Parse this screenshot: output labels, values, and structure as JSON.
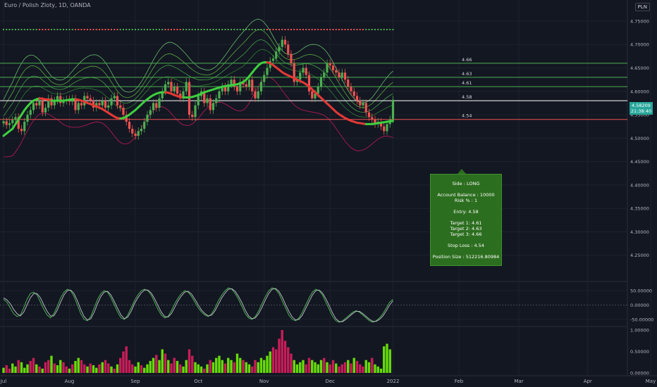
{
  "header": {
    "title": "Euro / Polish Zloty, 1D, OANDA",
    "currency": "PLN"
  },
  "chart_data": [
    {
      "type": "line",
      "title": "Euro / Polish Zloty, 1D, OANDA",
      "ylim": [
        4.2,
        4.78
      ],
      "y_ticks": [
        "4.75000",
        "4.70000",
        "4.65000",
        "4.60000",
        "4.55000",
        "4.50000",
        "4.45000",
        "4.40000",
        "4.35000",
        "4.30000",
        "4.25000"
      ],
      "y_tick_values": [
        4.75,
        4.7,
        4.65,
        4.6,
        4.55,
        4.5,
        4.45,
        4.4,
        4.35,
        4.3,
        4.25
      ],
      "x_ticks": [
        "Jul",
        "Aug",
        "Sep",
        "Oct",
        "Nov",
        "Dec",
        "2022",
        "Feb",
        "Mar",
        "Apr",
        "May",
        "Jun"
      ],
      "x_tick_index": [
        0,
        22,
        44,
        65,
        87,
        109,
        130,
        152,
        172,
        195,
        216,
        238
      ],
      "series": [
        {
          "values": [
            4.536,
            4.528,
            4.532,
            4.539,
            4.545,
            4.52,
            4.515,
            4.535,
            4.55,
            4.56,
            4.575,
            4.57,
            4.58,
            4.555,
            4.565,
            4.585,
            4.57,
            4.58,
            4.59,
            4.575,
            4.58,
            4.583,
            4.578,
            4.585,
            4.56,
            4.575,
            4.57,
            4.59,
            4.585,
            4.58,
            4.565,
            4.575,
            4.57,
            4.58,
            4.565,
            4.57,
            4.585,
            4.59,
            4.57,
            4.565,
            4.55,
            4.535,
            4.52,
            4.51,
            4.505,
            4.515,
            4.52,
            4.535,
            4.55,
            4.56,
            4.575,
            4.565,
            4.585,
            4.6,
            4.615,
            4.62,
            4.6,
            4.61,
            4.595,
            4.585,
            4.6,
            4.62,
            4.55,
            4.545,
            4.57,
            4.59,
            4.6,
            4.575,
            4.585,
            4.56,
            4.575,
            4.585,
            4.6,
            4.61,
            4.6,
            4.615,
            4.625,
            4.61,
            4.6,
            4.62,
            4.615,
            4.61,
            4.625,
            4.6,
            4.585,
            4.6,
            4.62,
            4.635,
            4.65,
            4.665,
            4.67,
            4.685,
            4.695,
            4.71,
            4.7,
            4.68,
            4.66,
            4.62,
            4.625,
            4.64,
            4.65,
            4.635,
            4.6,
            4.585,
            4.595,
            4.61,
            4.63,
            4.64,
            4.66,
            4.655,
            4.645,
            4.64,
            4.63,
            4.64,
            4.625,
            4.61,
            4.6,
            4.59,
            4.58,
            4.57,
            4.575,
            4.555,
            4.545,
            4.54,
            4.53,
            4.535,
            4.525,
            4.515,
            4.53,
            4.54,
            4.58209
          ],
          "mode": "candles"
        },
        {
          "name": "",
          "values": [
            4.505,
            4.51,
            4.515,
            4.52,
            4.53,
            4.54,
            4.55,
            4.56,
            4.568,
            4.575,
            4.58,
            4.583,
            4.585,
            4.584,
            4.583,
            4.582,
            4.58,
            4.58,
            4.58,
            4.58,
            4.58,
            4.581,
            4.582,
            4.583,
            4.583,
            4.582,
            4.58,
            4.578,
            4.575,
            4.573,
            4.57,
            4.568,
            4.565,
            4.562,
            4.558,
            4.554,
            4.55,
            4.546,
            4.543,
            4.542,
            4.543,
            4.546,
            4.55,
            4.555,
            4.56,
            4.566,
            4.572,
            4.578,
            4.583,
            4.588,
            4.592,
            4.595,
            4.597,
            4.598,
            4.598,
            4.597,
            4.595,
            4.592,
            4.59,
            4.588,
            4.587,
            4.587,
            4.587,
            4.588,
            4.59,
            4.592,
            4.595,
            4.598,
            4.6,
            4.602,
            4.604,
            4.606,
            4.608,
            4.61,
            4.611,
            4.612,
            4.613,
            4.614,
            4.615,
            4.617,
            4.62,
            4.625,
            4.632,
            4.64,
            4.648,
            4.655,
            4.66,
            4.662,
            4.662,
            4.66,
            4.656,
            4.651,
            4.646,
            4.641,
            4.637,
            4.634,
            4.631,
            4.628,
            4.625,
            4.622,
            4.619,
            4.615,
            4.61,
            4.604,
            4.598,
            4.592,
            4.586,
            4.58,
            4.574,
            4.568,
            4.562,
            4.556,
            4.551,
            4.547,
            4.543,
            4.54,
            4.537,
            4.535,
            4.533,
            4.532,
            4.531,
            4.53,
            4.53,
            4.53,
            4.531,
            4.532,
            4.533,
            4.534,
            4.535,
            4.536,
            4.537
          ],
          "mode": "trend"
        }
      ],
      "annotations": [
        "4.66",
        "4.63",
        "4.61",
        "4.58",
        "4.54"
      ],
      "annotation_values": [
        4.66,
        4.63,
        4.61,
        4.58,
        4.54
      ],
      "annotation_colors": [
        "#4caf50",
        "#4caf50",
        "#4caf50",
        "#ffffff",
        "#ef5350"
      ],
      "last_price": "4.58209",
      "countdown": "21:38:40"
    },
    {
      "type": "line",
      "ylim": [
        -70,
        70
      ],
      "y_ticks": [
        "50.00000",
        "0.00000",
        "-50.00000"
      ],
      "y_tick_values": [
        50,
        0,
        -50
      ],
      "series": [
        {
          "name": "",
          "values": [
            20,
            10,
            -10,
            -30,
            -40,
            -35,
            -10,
            20,
            40,
            45,
            35,
            10,
            -15,
            -35,
            -45,
            -30,
            -5,
            25,
            45,
            55,
            50,
            30,
            0,
            -30,
            -50,
            -55,
            -40,
            -10,
            20,
            40,
            50,
            45,
            25,
            0,
            -25,
            -45,
            -50,
            -35,
            -10,
            15,
            35,
            50,
            55,
            50,
            35,
            10,
            -15,
            -35,
            -45,
            -40,
            -20,
            5,
            25,
            40,
            50,
            45,
            30,
            10,
            -10,
            -25,
            -35,
            -40,
            -30,
            -10,
            15,
            35,
            50,
            60,
            55,
            40,
            20,
            -5,
            -30,
            -45,
            -50,
            -40,
            -20,
            5,
            30,
            50,
            60,
            55,
            40,
            15,
            -10,
            -35,
            -50,
            -55,
            -45,
            -25,
            0,
            25,
            45,
            55,
            50,
            35,
            10,
            -15,
            -40,
            -55,
            -60,
            -55,
            -45,
            -35,
            -25,
            -20,
            -25,
            -35,
            -45,
            -55,
            -60,
            -55,
            -45,
            -30,
            -10,
            10,
            20
          ],
          "mode": "osc",
          "color": "#4caf50"
        },
        {
          "name": "",
          "values": [
            25,
            18,
            5,
            -15,
            -30,
            -38,
            -25,
            0,
            25,
            40,
            40,
            25,
            0,
            -22,
            -38,
            -38,
            -18,
            10,
            35,
            50,
            52,
            40,
            15,
            -15,
            -40,
            -52,
            -48,
            -25,
            5,
            30,
            45,
            48,
            35,
            12,
            -12,
            -35,
            -48,
            -42,
            -22,
            5,
            25,
            42,
            52,
            52,
            42,
            22,
            -2,
            -25,
            -40,
            -42,
            -30,
            -8,
            15,
            32,
            45,
            48,
            38,
            20,
            0,
            -18,
            -30,
            -38,
            -35,
            -20,
            2,
            25,
            42,
            55,
            57,
            48,
            30,
            8,
            -18,
            -38,
            -48,
            -45,
            -30,
            -8,
            18,
            40,
            55,
            58,
            48,
            28,
            2,
            -22,
            -42,
            -52,
            -50,
            -35,
            -12,
            12,
            35,
            50,
            52,
            42,
            22,
            -2,
            -28,
            -48,
            -58,
            -58,
            -50,
            -40,
            -30,
            -22,
            -22,
            -30,
            -40,
            -50,
            -57,
            -57,
            -50,
            -38,
            -20,
            0,
            15
          ],
          "mode": "osc",
          "color": "#b2b5be"
        }
      ]
    },
    {
      "type": "bar",
      "ylim": [
        0,
        1.05
      ],
      "y_ticks": [
        "1.00000",
        "0.50000",
        "0.00000"
      ],
      "y_tick_values": [
        1.0,
        0.5,
        0.0
      ],
      "values": [
        0.12,
        0.18,
        0.1,
        0.22,
        0.15,
        0.3,
        0.25,
        0.12,
        0.2,
        0.28,
        0.35,
        0.2,
        0.15,
        0.1,
        0.25,
        0.3,
        0.4,
        0.22,
        0.18,
        0.3,
        0.25,
        0.15,
        0.1,
        0.2,
        0.28,
        0.35,
        0.3,
        0.2,
        0.15,
        0.22,
        0.18,
        0.12,
        0.2,
        0.25,
        0.3,
        0.22,
        0.15,
        0.1,
        0.2,
        0.35,
        0.5,
        0.62,
        0.3,
        0.2,
        0.15,
        0.25,
        0.18,
        0.12,
        0.2,
        0.28,
        0.35,
        0.42,
        0.3,
        0.55,
        0.45,
        0.3,
        0.22,
        0.35,
        0.28,
        0.2,
        0.15,
        0.3,
        0.55,
        0.4,
        0.25,
        0.2,
        0.15,
        0.1,
        0.2,
        0.3,
        0.25,
        0.35,
        0.4,
        0.3,
        0.22,
        0.35,
        0.3,
        0.25,
        0.45,
        0.35,
        0.3,
        0.25,
        0.2,
        0.15,
        0.3,
        0.25,
        0.35,
        0.3,
        0.4,
        0.5,
        0.6,
        0.55,
        0.8,
        1.0,
        0.75,
        0.6,
        0.45,
        0.3,
        0.2,
        0.25,
        0.3,
        0.2,
        0.35,
        0.3,
        0.25,
        0.2,
        0.3,
        0.35,
        0.25,
        0.2,
        0.3,
        0.22,
        0.15,
        0.2,
        0.25,
        0.3,
        0.22,
        0.35,
        0.28,
        0.2,
        0.15,
        0.3,
        0.25,
        0.35,
        0.2,
        0.15,
        0.1,
        0.62,
        0.68,
        0.55
      ],
      "bar_colors": [
        "g",
        "r",
        "r",
        "g",
        "g",
        "r",
        "g",
        "g",
        "g",
        "r",
        "r",
        "g",
        "r",
        "g",
        "r",
        "r",
        "g",
        "r",
        "g",
        "g",
        "r",
        "r",
        "g",
        "r",
        "g",
        "g",
        "r",
        "r",
        "g",
        "r",
        "g",
        "g",
        "r",
        "g",
        "r",
        "r",
        "g",
        "r",
        "g",
        "r",
        "r",
        "r",
        "r",
        "r",
        "g",
        "g",
        "r",
        "g",
        "g",
        "g",
        "g",
        "r",
        "g",
        "g",
        "r",
        "g",
        "r",
        "r",
        "g",
        "r",
        "g",
        "g",
        "r",
        "r",
        "g",
        "g",
        "g",
        "r",
        "g",
        "r",
        "g",
        "g",
        "g",
        "g",
        "r",
        "g",
        "g",
        "r",
        "g",
        "g",
        "r",
        "g",
        "g",
        "r",
        "r",
        "g",
        "g",
        "g",
        "g",
        "g",
        "r",
        "r",
        "r",
        "r",
        "r",
        "r",
        "r",
        "g",
        "g",
        "g",
        "g",
        "r",
        "r",
        "g",
        "g",
        "g",
        "g",
        "r",
        "g",
        "r",
        "r",
        "g",
        "r",
        "r",
        "r",
        "g",
        "r",
        "g",
        "r",
        "r",
        "r",
        "g",
        "g",
        "r",
        "g",
        "g",
        "g",
        "g",
        "g",
        "g"
      ]
    }
  ],
  "position_panel": {
    "side": "Side : LONG",
    "balance": "Account Balance : 10000",
    "risk": "Risk % : 1",
    "entry": "Entry: 4.58",
    "target1": "Target 1: 4.61",
    "target2": "Target 2: 4.63",
    "target3": "Target 3: 4.66",
    "stop": "Stop Loss : 4.54",
    "size": "Position Size : 512216.80984"
  },
  "signals": {
    "osc_markers": [
      "R",
      "R",
      "R",
      "R",
      "R",
      "R",
      "R",
      "R",
      "R",
      "R"
    ],
    "osc_buy": [
      "L",
      "L",
      "BL",
      "L",
      "L"
    ]
  },
  "colors": {
    "bull": "#4caf50",
    "bear": "#ef5350",
    "background": "#131722",
    "grid": "#1e222d",
    "text": "#b2b5be"
  }
}
